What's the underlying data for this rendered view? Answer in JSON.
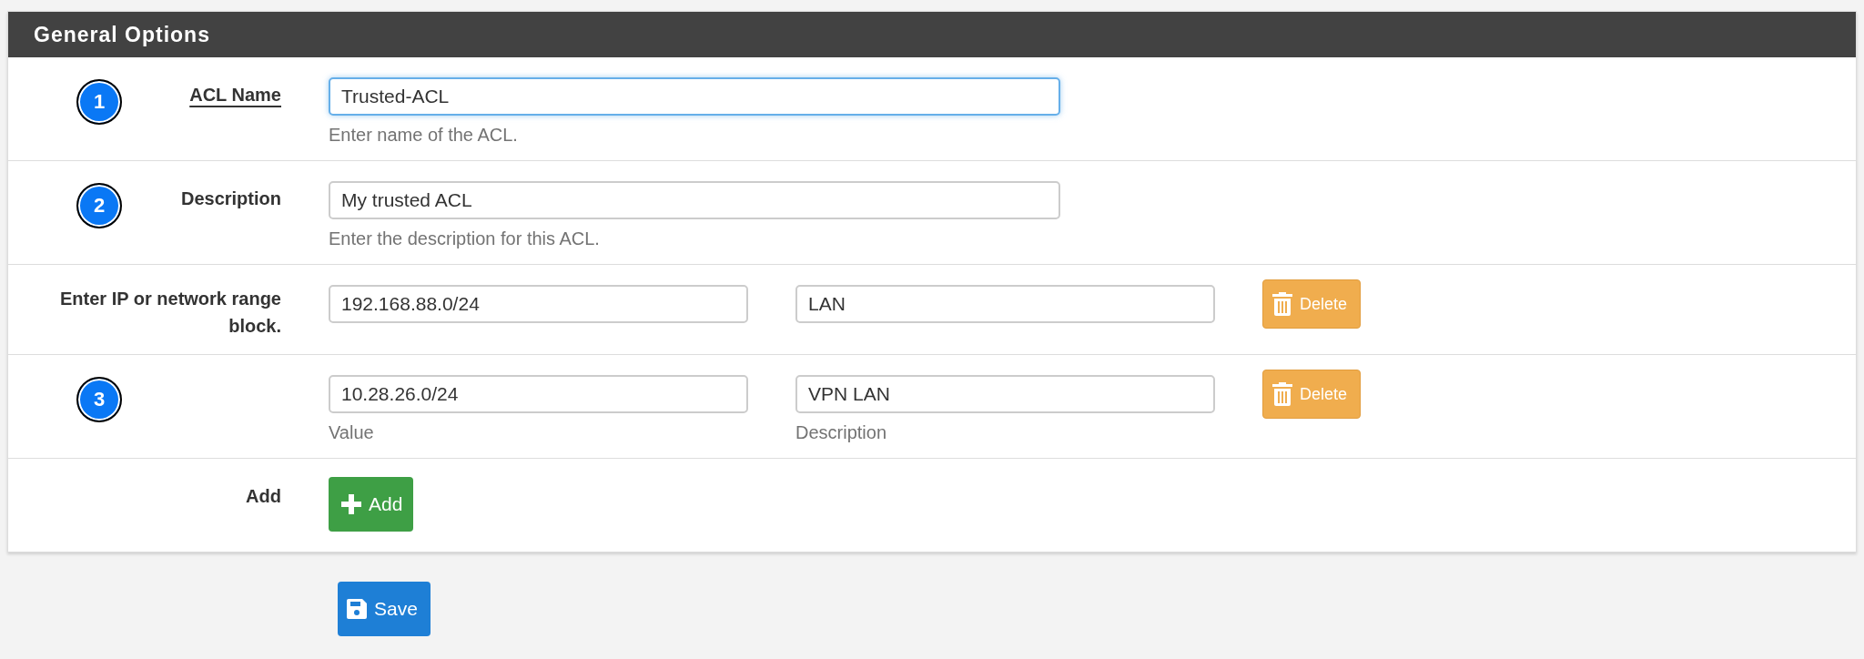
{
  "panel": {
    "title": "General Options",
    "rows": [
      {
        "kind": "text",
        "marker": "1",
        "label": "ACL Name",
        "value": "Trusted-ACL",
        "help": "Enter name of the ACL.",
        "focused": true
      },
      {
        "kind": "text",
        "marker": "2",
        "label": "Description",
        "value": "My trusted ACL",
        "help": "Enter the description for this ACL.",
        "focused": false
      },
      {
        "kind": "pair",
        "label": "Enter IP or network range block.",
        "value": "192.168.88.0/24",
        "description": "LAN",
        "button": "Delete"
      },
      {
        "kind": "pair",
        "marker": "3",
        "value": "10.28.26.0/24",
        "description": "VPN LAN",
        "button": "Delete",
        "value_help": "Value",
        "description_help": "Description"
      },
      {
        "kind": "add",
        "label": "Add",
        "button": "Add"
      }
    ]
  },
  "save_button": "Save"
}
